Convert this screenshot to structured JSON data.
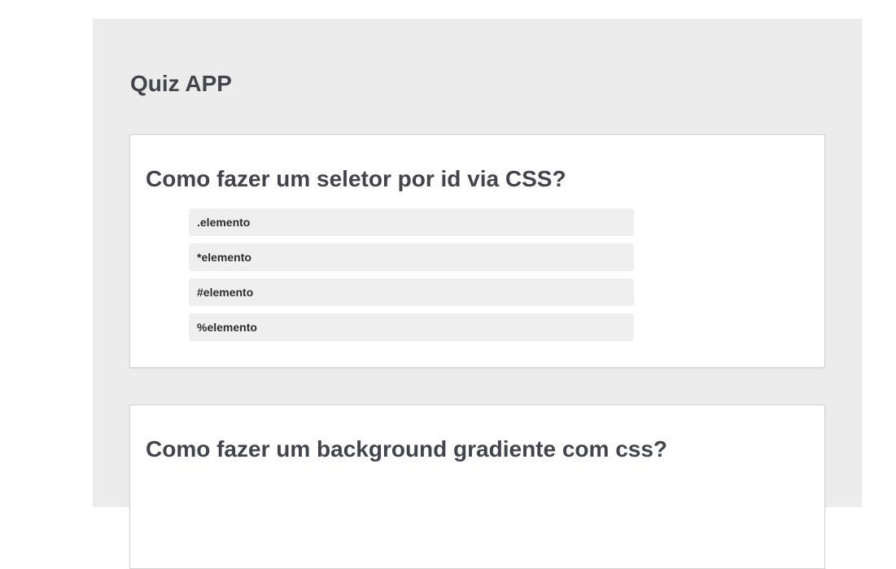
{
  "app": {
    "title": "Quiz APP"
  },
  "questions": [
    {
      "title": "Como fazer um seletor por id via CSS?",
      "answers": [
        ".elemento",
        "*elemento",
        "#elemento",
        "%elemento"
      ]
    },
    {
      "title": "Como fazer um background gradiente com css?"
    }
  ],
  "colors": {
    "page_background": "#ffffff",
    "container_background": "#ececec",
    "card_background": "#ffffff",
    "answer_background": "#efefef",
    "heading_text": "#44444d",
    "answer_text": "#2c2c2c"
  }
}
